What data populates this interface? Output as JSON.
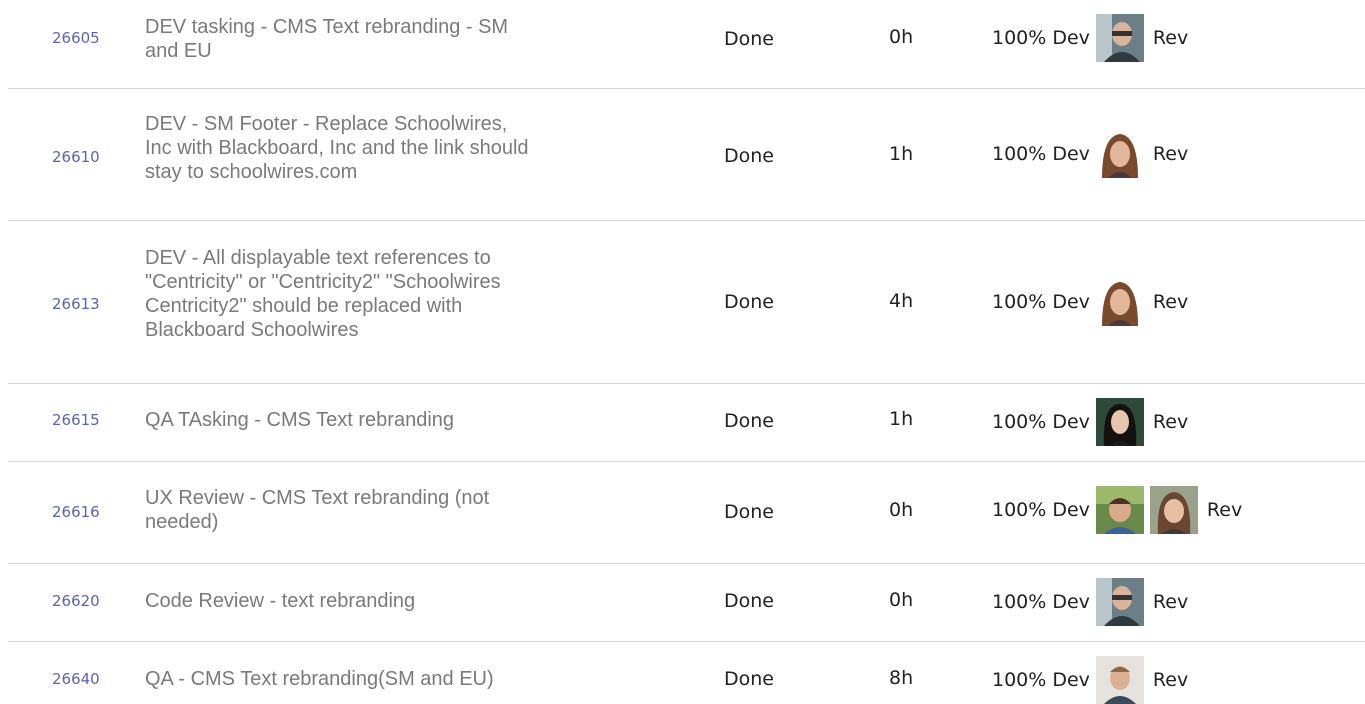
{
  "rows": [
    {
      "id": "26605",
      "title_lines": [
        "DEV tasking - CMS Text rebranding - SM",
        "and EU"
      ],
      "status": "Done",
      "hours": "0h",
      "percent": "100%",
      "dev_label": "Dev",
      "rev_label": "Rev",
      "avatars": [
        "avatar-man-glasses"
      ]
    },
    {
      "id": "26610",
      "title_lines": [
        "DEV - SM Footer - Replace Schoolwires,",
        "Inc with Blackboard, Inc and the link should",
        "stay to schoolwires.com"
      ],
      "status": "Done",
      "hours": "1h",
      "percent": "100%",
      "dev_label": "Dev",
      "rev_label": "Rev",
      "avatars": [
        "avatar-woman-brown-hair"
      ]
    },
    {
      "id": "26613",
      "title_lines": [
        "DEV - All displayable text references to",
        "\"Centricity\" or \"Centricity2\" \"Schoolwires",
        "Centricity2\" should be replaced with",
        "Blackboard Schoolwires"
      ],
      "status": "Done",
      "hours": "4h",
      "percent": "100%",
      "dev_label": "Dev",
      "rev_label": "Rev",
      "avatars": [
        "avatar-woman-brown-hair"
      ]
    },
    {
      "id": "26615",
      "title_lines": [
        "QA TAsking - CMS Text rebranding"
      ],
      "status": "Done",
      "hours": "1h",
      "percent": "100%",
      "dev_label": "Dev",
      "rev_label": "Rev",
      "avatars": [
        "avatar-woman-dark-hair"
      ]
    },
    {
      "id": "26616",
      "title_lines": [
        "UX Review - CMS Text rebranding (not",
        "needed)"
      ],
      "status": "Done",
      "hours": "0h",
      "percent": "100%",
      "dev_label": "Dev",
      "rev_label": "Rev",
      "avatars": [
        "avatar-man-outdoors",
        "avatar-woman-smiling"
      ]
    },
    {
      "id": "26620",
      "title_lines": [
        "Code Review - text rebranding"
      ],
      "status": "Done",
      "hours": "0h",
      "percent": "100%",
      "dev_label": "Dev",
      "rev_label": "Rev",
      "avatars": [
        "avatar-man-glasses"
      ]
    },
    {
      "id": "26640",
      "title_lines": [
        "QA - CMS Text rebranding(SM and EU)"
      ],
      "status": "Done",
      "hours": "8h",
      "percent": "100%",
      "dev_label": "Dev",
      "rev_label": "Rev",
      "avatars": [
        "avatar-man-short-hair"
      ]
    }
  ],
  "colors": {
    "link": "#5b63b5",
    "title_text": "#7a7a7a",
    "body_text": "#222222",
    "row_divider": "#d7d7d7"
  }
}
